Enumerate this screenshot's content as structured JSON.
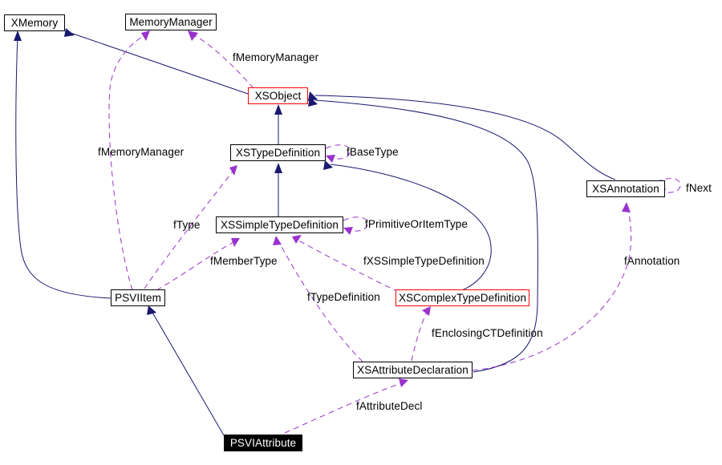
{
  "diagram": {
    "title": "PSVIAttribute collaboration diagram",
    "colors": {
      "inheritance_edge": "#191970",
      "usage_edge": "#9a32cd",
      "highlight_border": "#ff0000",
      "focus_fill": "#000000",
      "node_border": "#000000",
      "background": "#ffffff"
    },
    "nodes": [
      {
        "id": "xmemory",
        "label": "XMemory",
        "style": "plain"
      },
      {
        "id": "memorymanager",
        "label": "MemoryManager",
        "style": "plain"
      },
      {
        "id": "xsobject",
        "label": "XSObject",
        "style": "red"
      },
      {
        "id": "xstypedef",
        "label": "XSTypeDefinition",
        "style": "plain"
      },
      {
        "id": "xssimpletypedef",
        "label": "XSSimpleTypeDefinition",
        "style": "plain"
      },
      {
        "id": "xsannotation",
        "label": "XSAnnotation",
        "style": "plain"
      },
      {
        "id": "psviitem",
        "label": "PSVIItem",
        "style": "plain"
      },
      {
        "id": "xscomplextypedef",
        "label": "XSComplexTypeDefinition",
        "style": "red"
      },
      {
        "id": "xsattrdecl",
        "label": "XSAttributeDeclaration",
        "style": "plain"
      },
      {
        "id": "psviattribute",
        "label": "PSVIAttribute",
        "style": "focus"
      }
    ],
    "edge_labels": [
      {
        "id": "l-fmemorymanager-top",
        "text": "fMemoryManager"
      },
      {
        "id": "l-fbasetype",
        "text": "fBaseType"
      },
      {
        "id": "l-fmemorymanager-left",
        "text": "fMemoryManager"
      },
      {
        "id": "l-fnext",
        "text": "fNext"
      },
      {
        "id": "l-ftype",
        "text": "fType"
      },
      {
        "id": "l-fprimitiveoritemtype",
        "text": "fPrimitiveOrItemType"
      },
      {
        "id": "l-fmembertype",
        "text": "fMemberType"
      },
      {
        "id": "l-fxssimpletypedef",
        "text": "fXSSimpleTypeDefinition"
      },
      {
        "id": "l-fannotation",
        "text": "fAnnotation"
      },
      {
        "id": "l-ftypedefinition",
        "text": "fTypeDefinition"
      },
      {
        "id": "l-fenclosingctdef",
        "text": "fEnclosingCTDefinition"
      },
      {
        "id": "l-fattributedecl",
        "text": "fAttributeDecl"
      }
    ],
    "relations": [
      {
        "from": "psviitem",
        "to": "xmemory",
        "kind": "inheritance",
        "label": ""
      },
      {
        "from": "xsobject",
        "to": "xmemory",
        "kind": "inheritance",
        "label": ""
      },
      {
        "from": "xsobject",
        "to": "memorymanager",
        "kind": "usage",
        "label": "fMemoryManager"
      },
      {
        "from": "psviitem",
        "to": "memorymanager",
        "kind": "usage",
        "label": "fMemoryManager"
      },
      {
        "from": "xstypedef",
        "to": "xsobject",
        "kind": "inheritance",
        "label": ""
      },
      {
        "from": "xsannotation",
        "to": "xsobject",
        "kind": "inheritance",
        "label": ""
      },
      {
        "from": "xsattrdecl",
        "to": "xsobject",
        "kind": "inheritance",
        "label": ""
      },
      {
        "from": "xstypedef",
        "to": "xstypedef",
        "kind": "usage",
        "label": "fBaseType"
      },
      {
        "from": "xssimpletypedef",
        "to": "xstypedef",
        "kind": "inheritance",
        "label": ""
      },
      {
        "from": "xscomplextypedef",
        "to": "xstypedef",
        "kind": "inheritance",
        "label": ""
      },
      {
        "from": "psviitem",
        "to": "xstypedef",
        "kind": "usage",
        "label": "fType"
      },
      {
        "from": "xssimpletypedef",
        "to": "xssimpletypedef",
        "kind": "usage",
        "label": "fPrimitiveOrItemType"
      },
      {
        "from": "psviitem",
        "to": "xssimpletypedef",
        "kind": "usage",
        "label": "fMemberType"
      },
      {
        "from": "xscomplextypedef",
        "to": "xssimpletypedef",
        "kind": "usage",
        "label": "fXSSimpleTypeDefinition"
      },
      {
        "from": "xsattrdecl",
        "to": "xssimpletypedef",
        "kind": "usage",
        "label": "fTypeDefinition"
      },
      {
        "from": "xsannotation",
        "to": "xsannotation",
        "kind": "usage",
        "label": "fNext"
      },
      {
        "from": "xsattrdecl",
        "to": "xsannotation",
        "kind": "usage",
        "label": "fAnnotation"
      },
      {
        "from": "xsattrdecl",
        "to": "xscomplextypedef",
        "kind": "usage",
        "label": "fEnclosingCTDefinition"
      },
      {
        "from": "psviattribute",
        "to": "psviitem",
        "kind": "inheritance",
        "label": ""
      },
      {
        "from": "psviattribute",
        "to": "xsattrdecl",
        "kind": "usage",
        "label": "fAttributeDecl"
      }
    ]
  }
}
